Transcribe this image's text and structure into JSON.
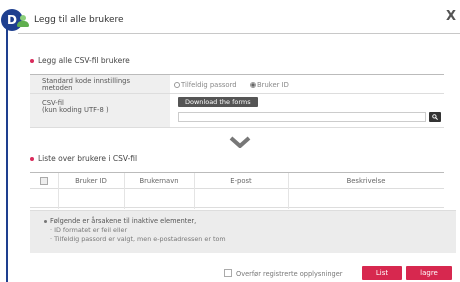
{
  "badge": "D",
  "dialog": {
    "title": "Legg til alle brukere",
    "close_label": "X"
  },
  "csv_section": {
    "title": "Legg alle CSV-fil brukere",
    "standard_code_label_1": "Standard kode innstillings",
    "standard_code_label_2": "metoden",
    "radio_options": [
      {
        "label": "Tilfeldig passord",
        "selected": false
      },
      {
        "label": "Bruker ID",
        "selected": true
      }
    ],
    "csv_label_1": "CSV-fil",
    "csv_label_2": "(kun koding UTF-8 )",
    "download_button": "Download the forms",
    "file_value": ""
  },
  "list_section": {
    "title": "Liste over brukere i CSV-fil",
    "columns": [
      "Bruker ID",
      "Brukernavn",
      "E-post",
      "Beskrivelse"
    ]
  },
  "notice": {
    "title": "Følgende er årsakene til inaktive elementer,",
    "lines": [
      "ID formatet er feil eller",
      "Tilfeldig passord er valgt, men e-postadressen er tom"
    ]
  },
  "footer": {
    "overwrite_label": "Overfør registrerte opplysninger",
    "overwrite_checked": false,
    "list_button": "List",
    "save_button": "lagre"
  },
  "colors": {
    "accent": "#d7284f",
    "badge": "#1e3f8f"
  }
}
